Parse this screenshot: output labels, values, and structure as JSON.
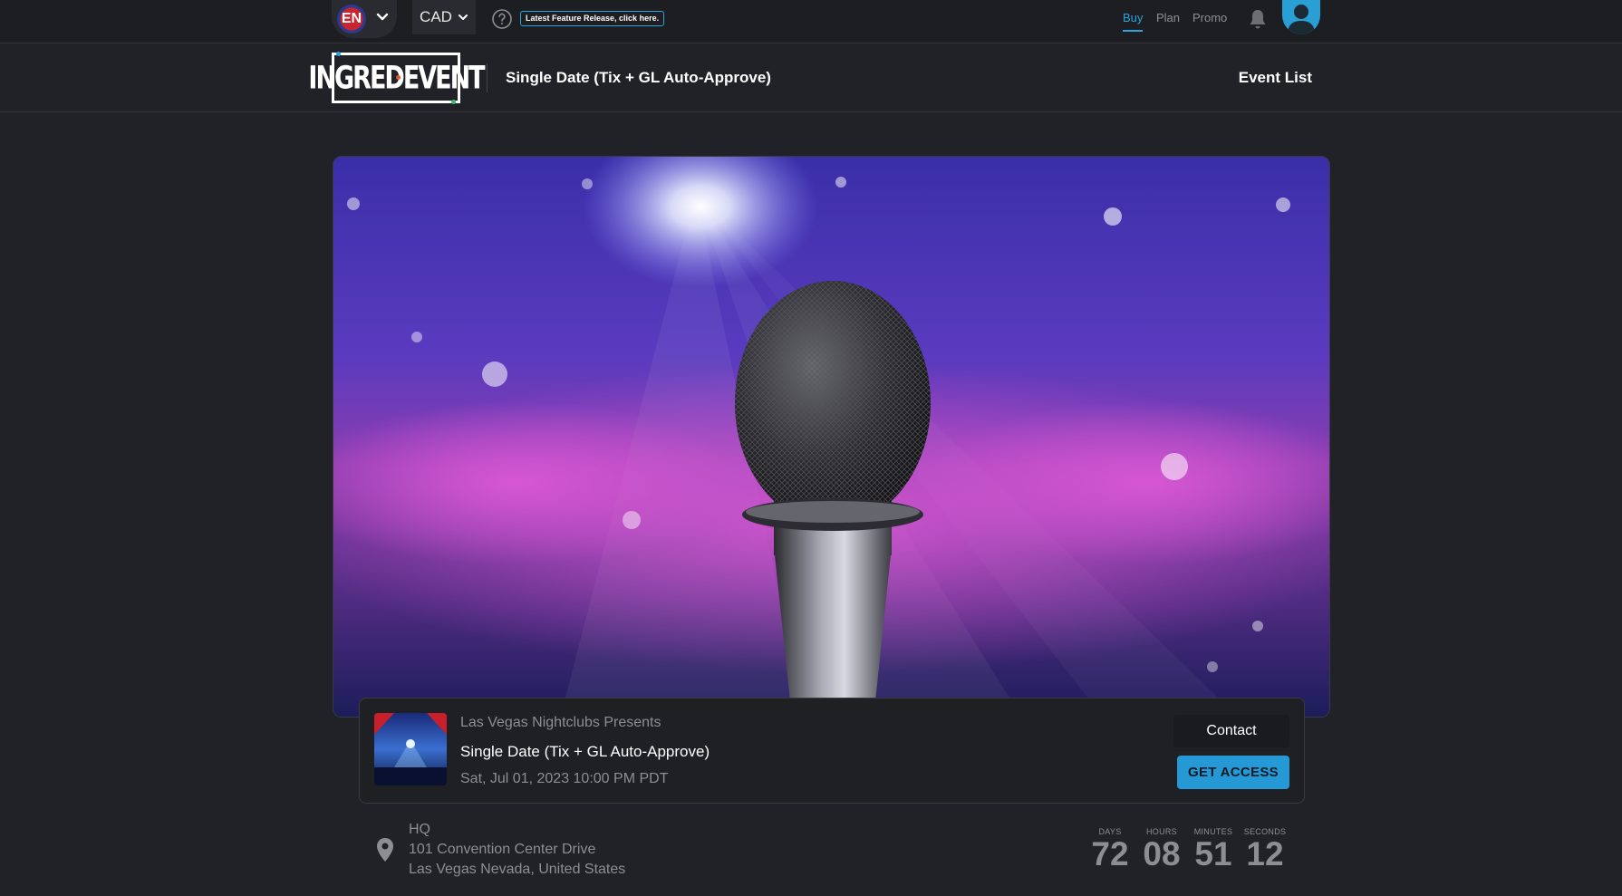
{
  "topbar": {
    "language": "EN",
    "currency": "CAD",
    "feature_release": "Latest Feature Release, click here.",
    "nav": [
      "Buy",
      "Plan",
      "Promo"
    ]
  },
  "header": {
    "logo_text": "INGREDEVENT",
    "event_title": "Single Date (Tix + GL Auto-Approve)",
    "event_list": "Event List"
  },
  "card": {
    "presenter": "Las Vegas Nightclubs Presents",
    "title": "Single Date (Tix + GL Auto-Approve)",
    "date": "Sat, Jul 01, 2023 10:00 PM PDT",
    "contact_label": "Contact",
    "access_label": "GET ACCESS"
  },
  "venue": {
    "name": "HQ",
    "address_line1": "101 Convention Center Drive",
    "address_line2": "Las Vegas Nevada, United States"
  },
  "countdown": {
    "days_label": "DAYS",
    "days": "72",
    "hours_label": "HOURS",
    "hours": "08",
    "minutes_label": "MINUTES",
    "minutes": "51",
    "seconds_label": "SECONDS",
    "seconds": "12"
  },
  "colors": {
    "accent": "#2aa3e0",
    "background": "#212227",
    "button": "#2599d6"
  }
}
